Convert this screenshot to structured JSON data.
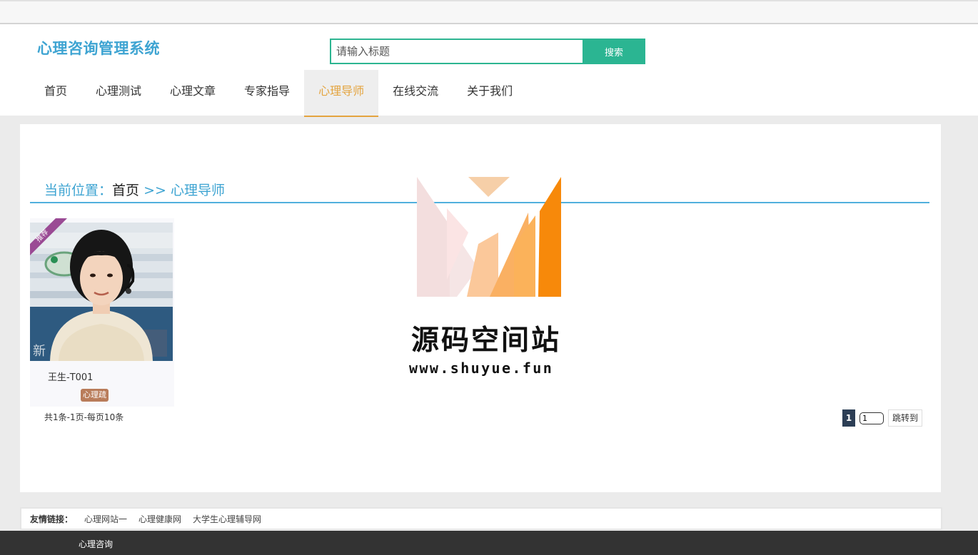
{
  "header": {
    "site_title": "心理咨询管理系统",
    "search_placeholder": "请输入标题",
    "search_button": "搜索"
  },
  "nav": {
    "items": [
      "首页",
      "心理测试",
      "心理文章",
      "专家指导",
      "心理导师",
      "在线交流",
      "关于我们"
    ],
    "active": "心理导师"
  },
  "breadcrumb": {
    "label": "当前位置：",
    "home": "首页",
    "separator": ">>",
    "current": "心理导师"
  },
  "card": {
    "ribbon": "推荐",
    "name": "王生-T001",
    "tag": "心理疏"
  },
  "pagination": {
    "info": "共1条-1页-每页10条",
    "current_page": "1",
    "input_value": "1",
    "jump_button": "跳转到"
  },
  "links": {
    "label": "友情链接：",
    "items": [
      "心理网站一",
      "心理健康网",
      "大学生心理辅导网"
    ]
  },
  "footer": {
    "text": "心理咨询"
  },
  "watermark": {
    "name": "源码空间站",
    "url": "www.shuyue.fun"
  },
  "colors": {
    "brand": "#3ea4d2",
    "search_green": "#2bb592",
    "nav_active": "#e4a43f",
    "tag_brown": "#b97c5a",
    "ribbon_purple": "#9a4a94",
    "footer_bg": "#333333"
  }
}
